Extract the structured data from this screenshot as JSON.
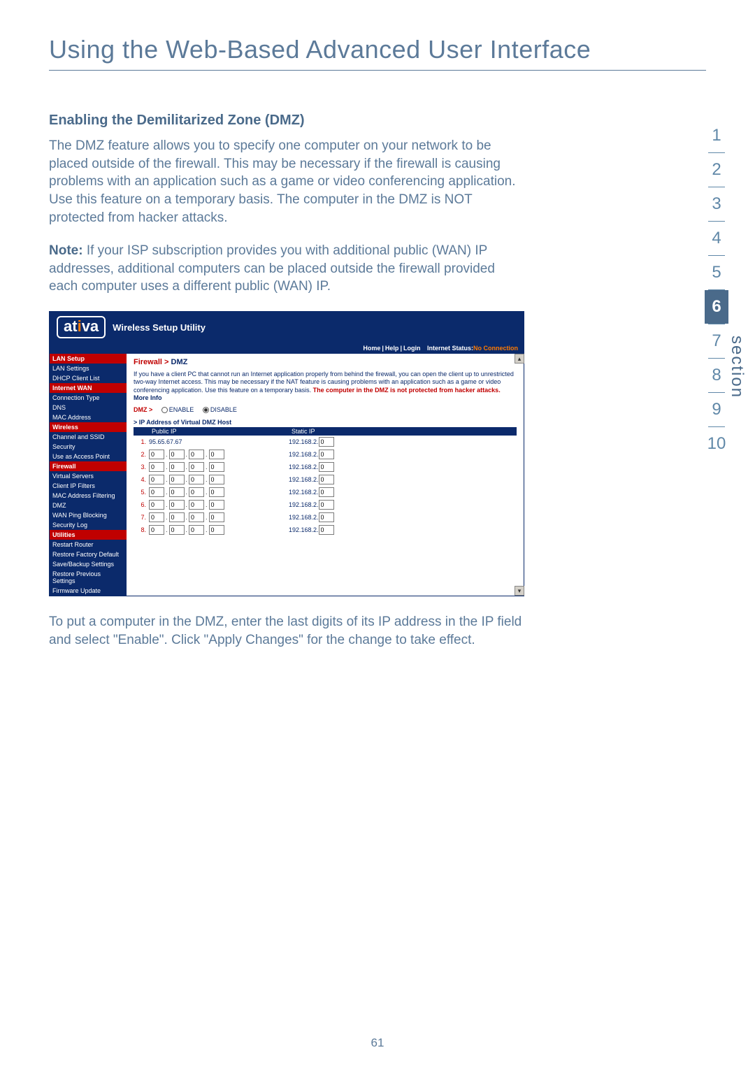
{
  "title": "Using the Web-Based Advanced User Interface",
  "subheading": "Enabling the Demilitarized Zone (DMZ)",
  "para1": "The DMZ feature allows you to specify one computer on your network to be placed outside of the firewall. This may be necessary if the firewall is causing problems with an application such as a game or video conferencing application. Use this feature on a temporary basis. The computer in the DMZ is NOT protected from hacker attacks.",
  "note_label": "Note:",
  "note_text": " If your ISP subscription provides you with additional public (WAN) IP addresses, additional computers can be placed outside the firewall provided each computer uses a different public (WAN) IP.",
  "para2": "To put a computer in the DMZ, enter the last digits of its IP address in the IP field and select \"Enable\". Click \"Apply Changes\" for the change to take effect.",
  "page_number": "61",
  "sectionnav": {
    "items": [
      "1",
      "2",
      "3",
      "4",
      "5",
      "6",
      "7",
      "8",
      "9",
      "10"
    ],
    "active_index": 5,
    "label": "section"
  },
  "shot": {
    "logo_pre": "at",
    "logo_dot": "i",
    "logo_post": "va",
    "headline": "Wireless Setup Utility",
    "nav": {
      "home": "Home",
      "help": "Help",
      "login": "Login",
      "status_label": "Internet Status:",
      "status_value": "No Connection"
    },
    "sidebar": [
      {
        "type": "grp",
        "label": "LAN Setup"
      },
      {
        "type": "link",
        "label": "LAN Settings"
      },
      {
        "type": "link",
        "label": "DHCP Client List"
      },
      {
        "type": "grp",
        "label": "Internet WAN"
      },
      {
        "type": "link",
        "label": "Connection Type"
      },
      {
        "type": "link",
        "label": "DNS"
      },
      {
        "type": "link",
        "label": "MAC Address"
      },
      {
        "type": "grp",
        "label": "Wireless"
      },
      {
        "type": "link",
        "label": "Channel and SSID"
      },
      {
        "type": "link",
        "label": "Security"
      },
      {
        "type": "link",
        "label": "Use as Access Point"
      },
      {
        "type": "grp",
        "label": "Firewall"
      },
      {
        "type": "link",
        "label": "Virtual Servers"
      },
      {
        "type": "link",
        "label": "Client IP Filters"
      },
      {
        "type": "link",
        "label": "MAC Address Filtering"
      },
      {
        "type": "link",
        "label": "DMZ"
      },
      {
        "type": "link",
        "label": "WAN Ping Blocking"
      },
      {
        "type": "link",
        "label": "Security Log"
      },
      {
        "type": "grp",
        "label": "Utilities"
      },
      {
        "type": "link",
        "label": "Restart Router"
      },
      {
        "type": "link",
        "label": "Restore Factory Default"
      },
      {
        "type": "link",
        "label": "Save/Backup Settings"
      },
      {
        "type": "link",
        "label": "Restore Previous Settings"
      },
      {
        "type": "link",
        "label": "Firmware Update"
      }
    ],
    "crumb_parent": "Firewall >",
    "crumb_current": " DMZ",
    "desc_plain": "If you have a client PC that cannot run an Internet application properly from behind the firewall, you can open the client up to unrestricted two-way Internet access. This may be necessary if the NAT feature is causing problems with an application such as a game or video conferencing application. Use this feature on a temporary basis. ",
    "desc_warn": "The computer in the DMZ is not protected from hacker attacks.",
    "desc_more": " More Info",
    "dmz_label": "DMZ >",
    "enable": "ENABLE",
    "disable": "DISABLE",
    "table_caption": "> IP Address of Virtual DMZ Host",
    "col_public": "Public IP",
    "col_static": "Static IP",
    "rows": [
      {
        "n": "1.",
        "public_text": "95.65.67.67",
        "static_prefix": "192.168.2.",
        "static_last": "0"
      },
      {
        "n": "2.",
        "oct": [
          "0",
          "0",
          "0",
          "0"
        ],
        "static_prefix": "192.168.2.",
        "static_last": "0"
      },
      {
        "n": "3.",
        "oct": [
          "0",
          "0",
          "0",
          "0"
        ],
        "static_prefix": "192.168.2.",
        "static_last": "0"
      },
      {
        "n": "4.",
        "oct": [
          "0",
          "0",
          "0",
          "0"
        ],
        "static_prefix": "192.168.2.",
        "static_last": "0"
      },
      {
        "n": "5.",
        "oct": [
          "0",
          "0",
          "0",
          "0"
        ],
        "static_prefix": "192.168.2.",
        "static_last": "0"
      },
      {
        "n": "6.",
        "oct": [
          "0",
          "0",
          "0",
          "0"
        ],
        "static_prefix": "192.168.2.",
        "static_last": "0"
      },
      {
        "n": "7.",
        "oct": [
          "0",
          "0",
          "0",
          "0"
        ],
        "static_prefix": "192.168.2.",
        "static_last": "0"
      },
      {
        "n": "8.",
        "oct": [
          "0",
          "0",
          "0",
          "0"
        ],
        "static_prefix": "192.168.2.",
        "static_last": "0"
      }
    ]
  }
}
